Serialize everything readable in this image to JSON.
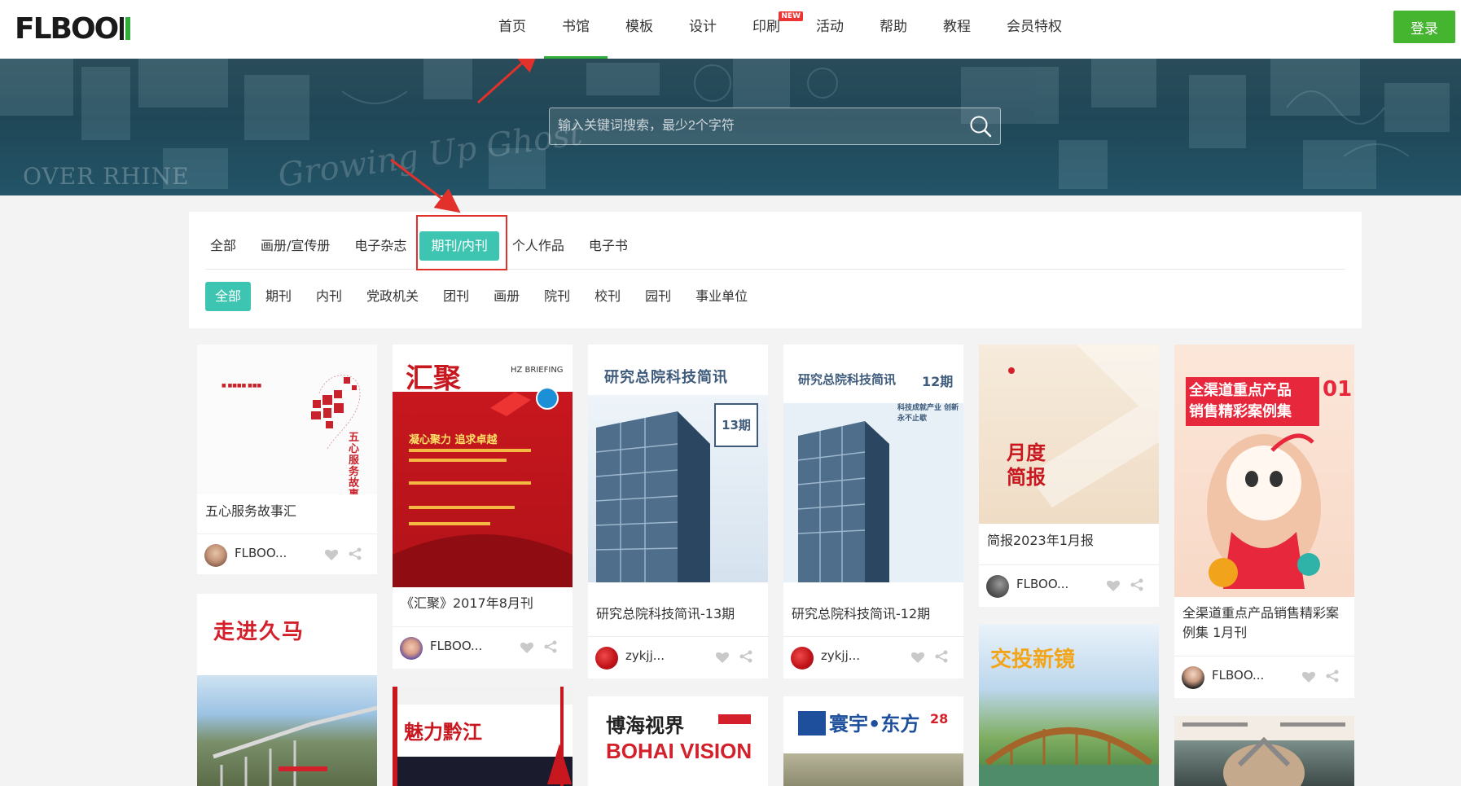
{
  "logo_text": "FLBOO",
  "nav": {
    "items": [
      {
        "label": "首页"
      },
      {
        "label": "书馆"
      },
      {
        "label": "模板"
      },
      {
        "label": "设计"
      },
      {
        "label": "印刷",
        "badge": "NEW"
      },
      {
        "label": "活动"
      },
      {
        "label": "帮助"
      },
      {
        "label": "教程"
      },
      {
        "label": "会员特权"
      }
    ],
    "active_index": 1,
    "login_label": "登录"
  },
  "search": {
    "placeholder": "输入关键词搜索，最少2个字符"
  },
  "hero_deco": {
    "text1": "OVER RHINE",
    "text2": "Growing Up Ghost"
  },
  "categories": {
    "items": [
      "全部",
      "画册/宣传册",
      "电子杂志",
      "期刊/内刊",
      "个人作品",
      "电子书"
    ],
    "active_index": 3
  },
  "subcategories": {
    "items": [
      "全部",
      "期刊",
      "内刊",
      "党政机关",
      "团刊",
      "画册",
      "院刊",
      "校刊",
      "园刊",
      "事业单位"
    ],
    "active_index": 0
  },
  "colors": {
    "accent": "#3ec5b1",
    "brand_green": "#45b52f",
    "highlight": "#e2302a"
  },
  "cards": [
    {
      "title": "五心服务故事汇",
      "author": "FLBOO...",
      "cover_text": "五心服务故事"
    },
    {
      "title": "《汇聚》2017年8月刊",
      "author": "FLBOO...",
      "cover_text": "汇聚",
      "cover_sub": "HZ BRIEFING",
      "cover_head": "凝心聚力 追求卓越"
    },
    {
      "title": "研究总院科技简讯-13期",
      "author": "zykjj...",
      "cover_text": "研究总院科技简讯",
      "cover_issue": "13期"
    },
    {
      "title": "研究总院科技简讯-12期",
      "author": "zykjj...",
      "cover_text": "研究总院科技简讯",
      "cover_issue": "12期",
      "cover_sub": "科技成就产业 创新永不止歇"
    },
    {
      "title": "简报2023年1月报",
      "author": "FLBOO...",
      "cover_text": "月度简报"
    },
    {
      "title": "全渠道重点产品销售精彩案例集 1月刊",
      "author": "FLBOO...",
      "cover_text": "全渠道重点产品",
      "cover_text2": "销售精彩案例集",
      "cover_issue": "01"
    },
    {
      "title": "",
      "author": "",
      "cover_text": "走进久马"
    },
    {
      "title": "",
      "author": "",
      "cover_text": "魅力黔江"
    },
    {
      "title": "",
      "author": "",
      "cover_text": "博海视界",
      "cover_sub": "BOHAI VISION"
    },
    {
      "title": "",
      "author": "",
      "cover_text": "寰宇•东方",
      "cover_issue": "28"
    },
    {
      "title": "",
      "author": "",
      "cover_text": "交投新镜"
    },
    {
      "title": "",
      "author": "",
      "cover_text": ""
    }
  ]
}
